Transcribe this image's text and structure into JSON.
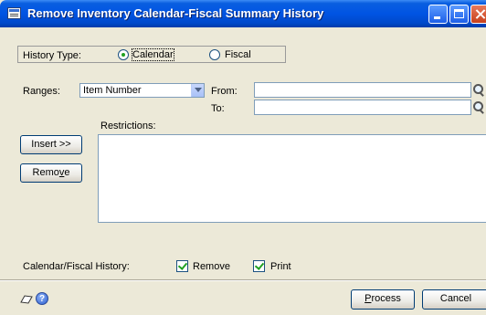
{
  "window": {
    "title": "Remove Inventory Calendar-Fiscal Summary History"
  },
  "history_type": {
    "label": "History Type:",
    "options": [
      {
        "label": "Calendar",
        "selected": true
      },
      {
        "label": "Fiscal",
        "selected": false
      }
    ]
  },
  "ranges": {
    "label": "Ranges:",
    "selected": "Item Number",
    "from_label": "From:",
    "to_label": "To:",
    "from_value": "",
    "to_value": ""
  },
  "restrictions": {
    "label": "Restrictions:",
    "insert_label": "Insert >>",
    "remove_label_pre": "Remo",
    "remove_label_u": "v",
    "remove_label_post": "e"
  },
  "history_options": {
    "label": "Calendar/Fiscal History:",
    "remove_label": "Remove",
    "remove_checked": true,
    "print_label": "Print",
    "print_checked": true
  },
  "footer": {
    "process_u": "P",
    "process_rest": "rocess",
    "cancel_label": "Cancel",
    "note_icon": "note-icon",
    "help_icon": "help-icon",
    "help_glyph": "?"
  }
}
